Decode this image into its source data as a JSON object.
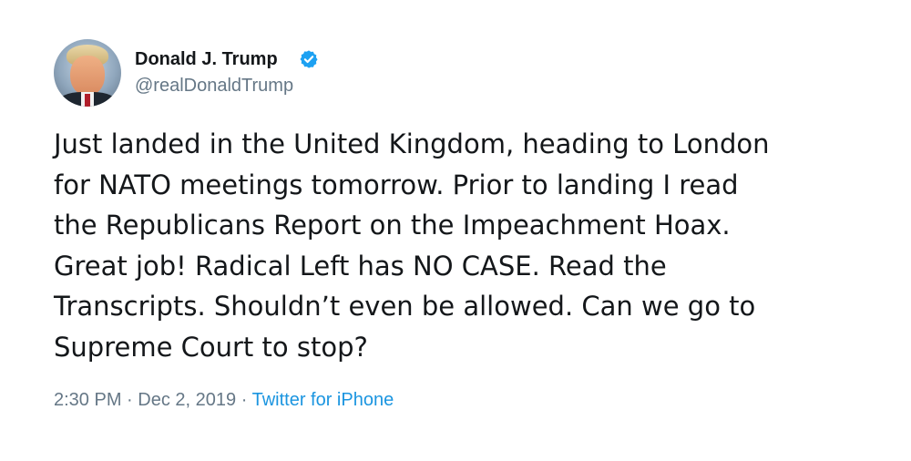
{
  "author": {
    "display_name": "Donald J. Trump",
    "handle": "@realDonaldTrump",
    "verified": true,
    "verified_icon": "verified-badge-icon"
  },
  "tweet": {
    "lines": [
      "Just landed in the United Kingdom, heading to London",
      "for NATO meetings tomorrow. Prior to landing I read",
      "the Republicans Report on the Impeachment Hoax.",
      "Great job! Radical Left has NO CASE. Read the",
      "Transcripts. Shouldn’t even be allowed. Can we go to",
      "Supreme Court to stop?"
    ]
  },
  "meta": {
    "time": "2:30 PM",
    "separator1": "·",
    "date": "Dec 2, 2019",
    "separator2": "·",
    "source": "Twitter for iPhone"
  },
  "colors": {
    "text": "#14171a",
    "secondary": "#657786",
    "link": "#1b95e0",
    "verified": "#1da1f2"
  }
}
